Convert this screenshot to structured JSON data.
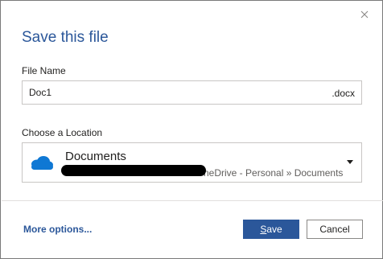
{
  "dialog": {
    "title": "Save this file",
    "close_icon": "close-icon"
  },
  "file_name": {
    "label": "File Name",
    "value": "Doc1",
    "extension": ".docx"
  },
  "location": {
    "label": "Choose a Location",
    "icon": "onedrive-cloud-icon",
    "name": "Documents",
    "path_visible": "neDrive - Personal » Documents",
    "caret_icon": "chevron-down-icon"
  },
  "footer": {
    "more_options": "More options...",
    "save_first": "S",
    "save_rest": "ave",
    "cancel": "Cancel"
  },
  "colors": {
    "accent": "#2b579a",
    "onedrive_blue": "#0f78d4"
  }
}
